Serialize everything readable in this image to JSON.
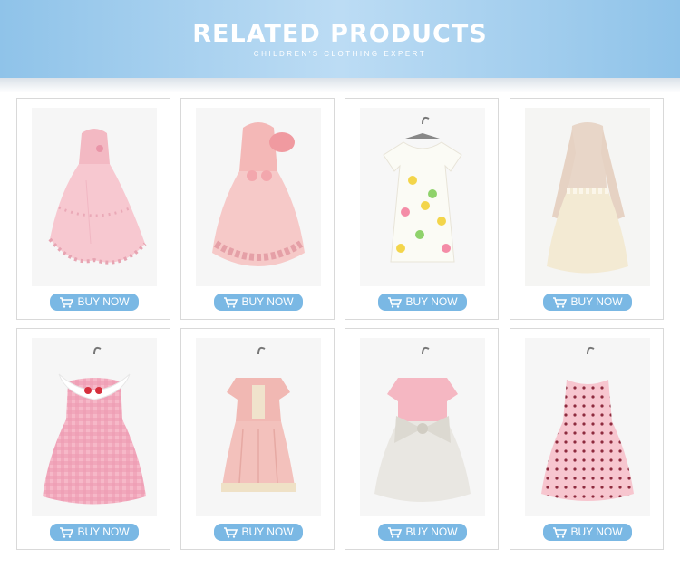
{
  "header": {
    "title": "RELATED PRODUCTS",
    "subtitle": "CHILDREN'S CLOTHING EXPERT"
  },
  "products": [
    {
      "button_label": "BUY NOW",
      "image": "pink-lace-tutu-dress"
    },
    {
      "button_label": "BUY NOW",
      "image": "pink-floral-bow-dress"
    },
    {
      "button_label": "BUY NOW",
      "image": "pineapple-print-dress"
    },
    {
      "button_label": "BUY NOW",
      "image": "beige-long-sleeve-dress"
    },
    {
      "button_label": "BUY NOW",
      "image": "pink-gingham-cherry-dress"
    },
    {
      "button_label": "BUY NOW",
      "image": "pink-flutter-sleeve-dress"
    },
    {
      "button_label": "BUY NOW",
      "image": "pink-bow-tulle-dress"
    },
    {
      "button_label": "BUY NOW",
      "image": "pink-dot-sleeveless-dress"
    }
  ],
  "colors": {
    "header": "#9fcdee",
    "button": "#7ab8e4",
    "card_border": "#d9d9d9"
  },
  "icons": {
    "button_icon": "shopping-cart-icon"
  }
}
